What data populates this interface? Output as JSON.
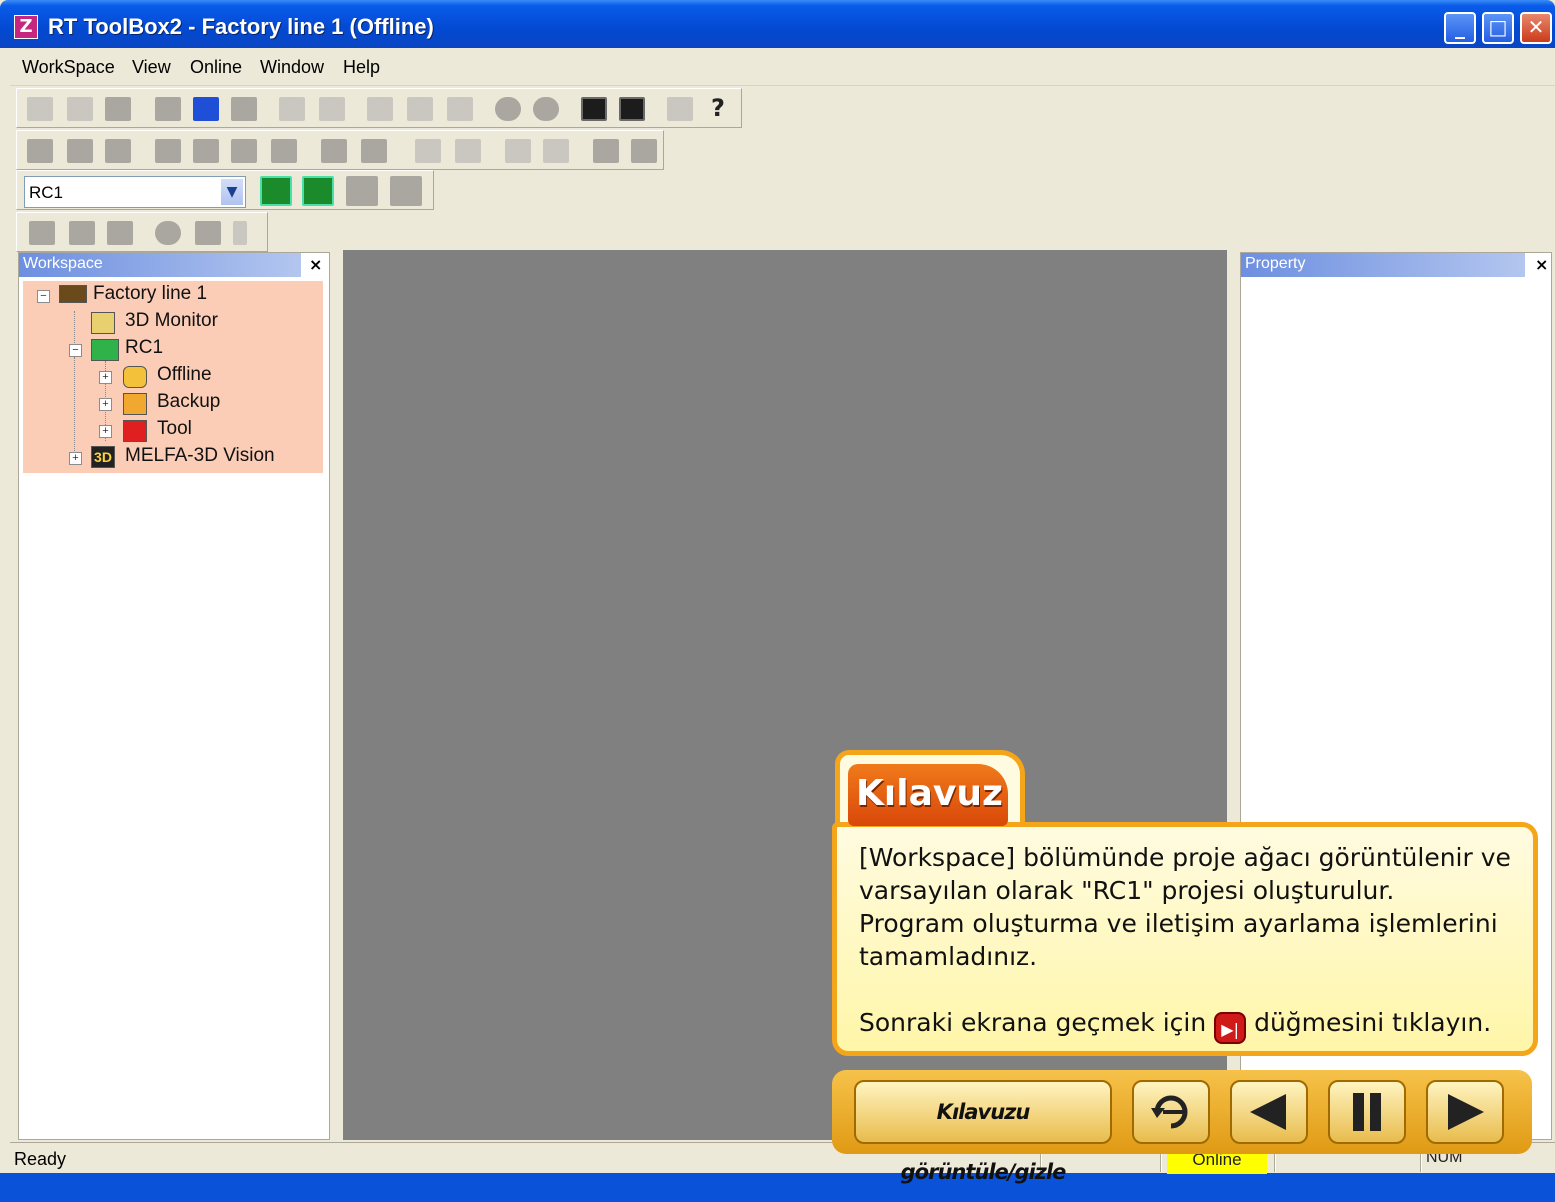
{
  "window": {
    "title": "RT ToolBox2 - Factory line 1  (Offline)",
    "app_icon": "rt-toolbox-icon",
    "minimize": "_",
    "maximize": "□",
    "close": "✕"
  },
  "menu": {
    "items": [
      {
        "label": "WorkSpace"
      },
      {
        "label": "View"
      },
      {
        "label": "Online"
      },
      {
        "label": "Window"
      },
      {
        "label": "Help"
      }
    ]
  },
  "toolbar": {
    "help_icon": "?",
    "controller_select": {
      "value": "RC1",
      "arrow": "▼"
    }
  },
  "workspace_panel": {
    "title": "Workspace",
    "close": "×",
    "tree": [
      {
        "label": "Factory line 1",
        "expander": "−",
        "icon": "factory-icon"
      },
      {
        "label": "3D Monitor",
        "icon": "3d-monitor-icon"
      },
      {
        "label": "RC1",
        "expander": "−",
        "icon": "controller-icon"
      },
      {
        "label": "Offline",
        "expander": "+",
        "icon": "offline-icon"
      },
      {
        "label": "Backup",
        "expander": "+",
        "icon": "backup-icon"
      },
      {
        "label": "Tool",
        "expander": "+",
        "icon": "tool-icon"
      },
      {
        "label": "MELFA-3D Vision",
        "expander": "+",
        "icon": "vision-icon",
        "icon_text": "3D"
      }
    ]
  },
  "property_panel": {
    "title": "Property",
    "close": "×"
  },
  "status": {
    "ready": "Ready",
    "online": "Online",
    "num": "NUM"
  },
  "guide": {
    "tab_label": "Kılavuz",
    "line1": "[Workspace] bölümünde proje ağacı görüntülenir ve",
    "line2": "varsayılan olarak \"RC1\" projesi oluşturulur.",
    "line3": "Program oluşturma ve iletişim ayarlama işlemlerini",
    "line4": "tamamladınız.",
    "line5_before": "Sonraki ekrana geçmek için",
    "line5_after": "düğmesini tıklayın.",
    "next_inline_icon": "▶|",
    "controls": {
      "toggle_label": "Kılavuzu görüntüle/gizle"
    }
  },
  "colors": {
    "tree_highlight": "#fbcdb7",
    "guide_border": "#f5a51a",
    "guide_tab": "#e45e10",
    "status_online": "#ffff00"
  }
}
